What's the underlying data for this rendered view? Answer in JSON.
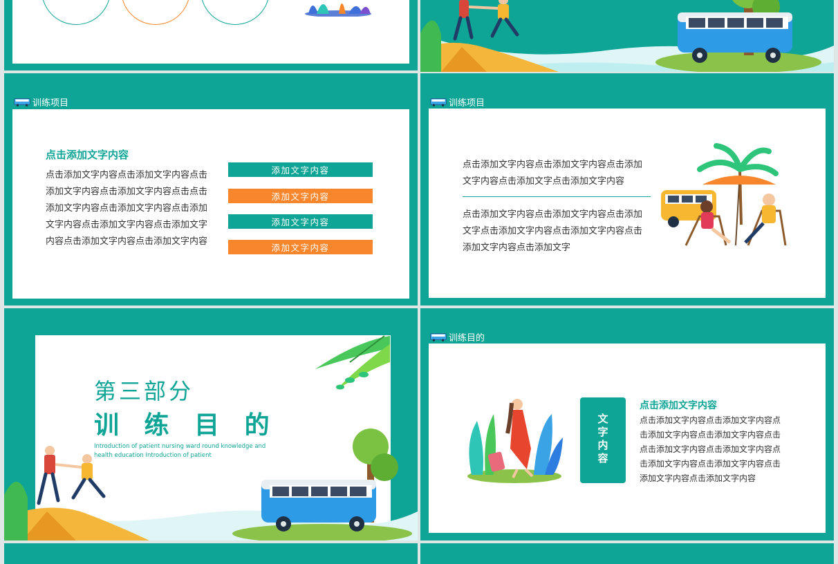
{
  "colors": {
    "teal": "#0fa596",
    "orange": "#f7862c",
    "white": "#ffffff",
    "text": "#333333"
  },
  "slide_section": {
    "header": "训练项目",
    "title": "点击添加文字内容",
    "body": "点击添加文字内容点击添加文字内容点击添加文字内容点击添加文字内容点击点击添加文字内容点击添加文字内容点击添加文字内容点击添加文字内容点击添加文字内容点击添加文字内容点击添加文字内容",
    "bars": [
      "添加文字内容",
      "添加文字内容",
      "添加文字内容",
      "添加文字内容"
    ]
  },
  "slide_beach": {
    "header": "训练项目",
    "para1": "点击添加文字内容点击添加文字内容点击添加文字内容点击添加文字点击添加文字内容",
    "para2": "点击添加文字内容点击添加文字内容点击添加文字点击添加文字内容点击添加文字内容点击添加文字内容点击添加文字"
  },
  "slide_part3": {
    "part_label": "第三部分",
    "title": "训 练 目 的",
    "subtitle": "Introduction of patient nursing ward round knowledge and health education Introduction of patient"
  },
  "slide_goal": {
    "header": "训练目的",
    "badge": "文字内容",
    "title": "点击添加文字内容",
    "body": "点击添加文字内容点击添加文字内容点击添加文字内容点击添加文字内容点击点击添加文字内容点击添加文字内容点击添加文字内容点击添加文字内容点击添加文字内容点击添加文字内容"
  }
}
